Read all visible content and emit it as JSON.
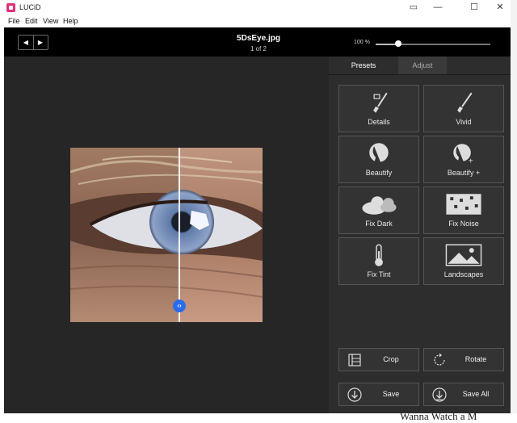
{
  "window": {
    "title": "LUCiD",
    "controls": {
      "tablet": "▭",
      "minimize": "—",
      "maximize": "☐",
      "close": "✕"
    }
  },
  "menu": {
    "items": [
      "File",
      "Edit",
      "View",
      "Help"
    ]
  },
  "toolbar": {
    "prev_glyph": "◀",
    "next_glyph": "▶",
    "filename": "5DsEye.jpg",
    "page": "1 of 2",
    "zoom_label": "100 %",
    "zoom_fraction": 0.2
  },
  "viewer": {
    "split_handle_glyph": "‹›"
  },
  "panel": {
    "tabs": [
      {
        "label": "Presets",
        "active": true
      },
      {
        "label": "Adjust",
        "active": false
      }
    ],
    "presets": [
      {
        "label": "Details",
        "icon": "brush-detail-icon"
      },
      {
        "label": "Vivid",
        "icon": "brush-icon"
      },
      {
        "label": "Beautify",
        "icon": "face-icon"
      },
      {
        "label": "Beautify +",
        "icon": "face-plus-icon"
      },
      {
        "label": "Fix Dark",
        "icon": "cloud-icon"
      },
      {
        "label": "Fix Noise",
        "icon": "noise-icon"
      },
      {
        "label": "Fix Tint",
        "icon": "thermometer-icon"
      },
      {
        "label": "Landscapes",
        "icon": "landscape-icon"
      }
    ],
    "actions": [
      {
        "label": "Crop",
        "icon": "crop-icon"
      },
      {
        "label": "Rotate",
        "icon": "rotate-icon"
      },
      {
        "label": "Save",
        "icon": "save-icon"
      },
      {
        "label": "Save All",
        "icon": "save-all-icon"
      }
    ]
  },
  "background": {
    "partial_text": "Wanna Watch a M"
  },
  "colors": {
    "accent": "#2a6cf0",
    "panel": "#2d2d2d",
    "toolbar": "#000000"
  }
}
